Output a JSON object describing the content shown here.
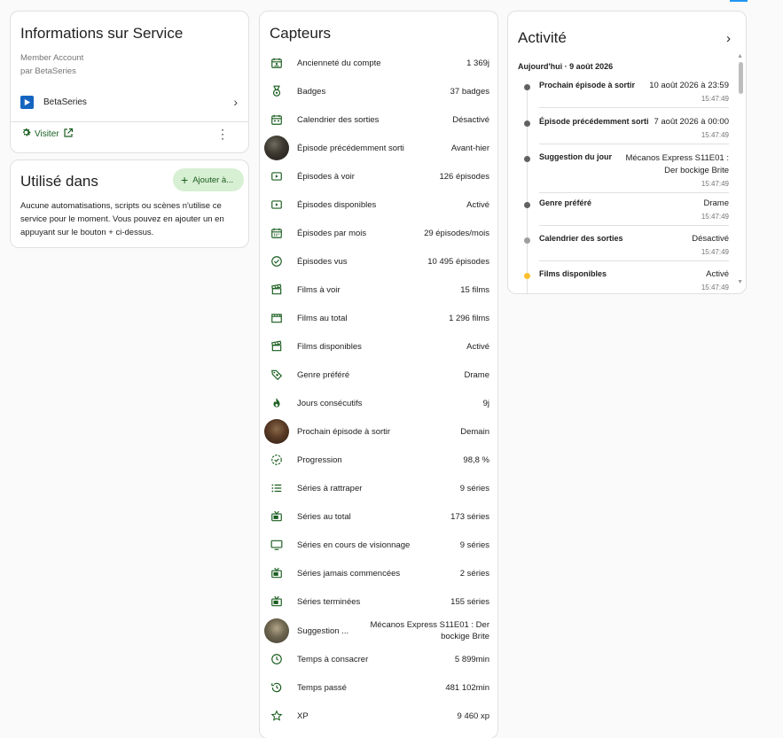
{
  "service": {
    "title": "Informations sur Service",
    "model": "Member Account",
    "manufacturer": "par BetaSeries",
    "integration": "BetaSeries",
    "visit_label": "Visiter"
  },
  "used_in": {
    "title": "Utilisé dans",
    "add_label": "Ajouter à...",
    "text": "Aucune automatisations, scripts ou scènes n'utilise ce service pour le moment. Vous pouvez en ajouter un en appuyant sur le bouton + ci-dessus."
  },
  "sensors": {
    "title": "Capteurs",
    "items": [
      {
        "name": "Ancienneté du compte",
        "value": "1 369j",
        "icon": "calendar-account-icon"
      },
      {
        "name": "Badges",
        "value": "37 badges",
        "icon": "medal-icon"
      },
      {
        "name": "Calendrier des sorties",
        "value": "Désactivé",
        "icon": "calendar-icon"
      },
      {
        "name": "Épisode précédemment sorti",
        "value": "Avant-hier",
        "icon": "avatar"
      },
      {
        "name": "Épisodes à voir",
        "value": "126 épisodes",
        "icon": "play-box-icon"
      },
      {
        "name": "Épisodes disponibles",
        "value": "Activé",
        "icon": "play-box-icon"
      },
      {
        "name": "Épisodes par mois",
        "value": "29 épisodes/mois",
        "icon": "calendar-month-icon"
      },
      {
        "name": "Épisodes vus",
        "value": "10 495 épisodes",
        "icon": "check-circle-icon"
      },
      {
        "name": "Films à voir",
        "value": "15 films",
        "icon": "movie-open-icon"
      },
      {
        "name": "Films au total",
        "value": "1 296 films",
        "icon": "movie-icon"
      },
      {
        "name": "Films disponibles",
        "value": "Activé",
        "icon": "movie-open-icon"
      },
      {
        "name": "Genre préféré",
        "value": "Drame",
        "icon": "tag-heart-icon"
      },
      {
        "name": "Jours consécutifs",
        "value": "9j",
        "icon": "fire-icon"
      },
      {
        "name": "Prochain épisode à sortir",
        "value": "Demain",
        "icon": "avatar"
      },
      {
        "name": "Progression",
        "value": "98,8 %",
        "icon": "progress-check-icon"
      },
      {
        "name": "Séries à rattraper",
        "value": "9 séries",
        "icon": "format-list-icon"
      },
      {
        "name": "Séries au total",
        "value": "173 séries",
        "icon": "television-classic-icon"
      },
      {
        "name": "Séries en cours de visionnage",
        "value": "9 séries",
        "icon": "television-icon"
      },
      {
        "name": "Séries jamais commencées",
        "value": "2 séries",
        "icon": "television-classic-icon"
      },
      {
        "name": "Séries terminées",
        "value": "155 séries",
        "icon": "television-classic-icon"
      },
      {
        "name": "Suggestion ...",
        "value": "Mécanos Express S11E01 : Der bockige Brite",
        "icon": "avatar"
      },
      {
        "name": "Temps à consacrer",
        "value": "5 899min",
        "icon": "clock-outline-icon"
      },
      {
        "name": "Temps passé",
        "value": "481 102min",
        "icon": "clock-history-icon"
      },
      {
        "name": "XP",
        "value": "9 460 xp",
        "icon": "star-outline-icon"
      }
    ]
  },
  "activity": {
    "title": "Activité",
    "date": "Aujourd'hui · 9 août 2026",
    "entries": [
      {
        "name": "Prochain épisode à sortir",
        "value": "10 août 2026 à 23:59",
        "time": "15:47:49",
        "dot": "#616161"
      },
      {
        "name": "Épisode précédemment sorti",
        "value": "7 août 2026 à 00:00",
        "time": "15:47:49",
        "dot": "#616161"
      },
      {
        "name": "Suggestion du jour",
        "value": "Mécanos Express S11E01 : Der bockige Brite",
        "time": "15:47:49",
        "dot": "#616161"
      },
      {
        "name": "Genre préféré",
        "value": "Drame",
        "time": "15:47:49",
        "dot": "#616161"
      },
      {
        "name": "Calendrier des sorties",
        "value": "Désactivé",
        "time": "15:47:49",
        "dot": "#9e9e9e"
      },
      {
        "name": "Films disponibles",
        "value": "Activé",
        "time": "15:47:49",
        "dot": "#fbc02d"
      }
    ]
  }
}
